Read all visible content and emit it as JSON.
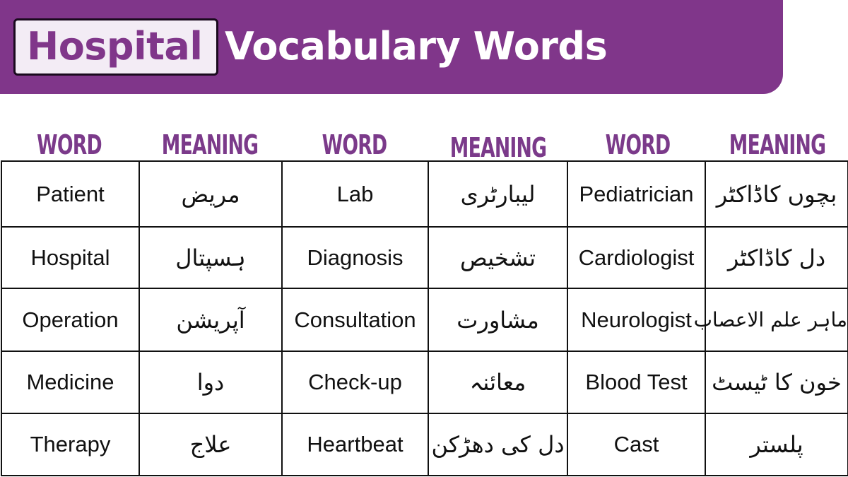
{
  "title": {
    "highlight": "Hospital",
    "rest": "Vocabulary Words"
  },
  "colors": {
    "brand_purple": "#80368a",
    "header_purple": "#7b3a8a",
    "highlight_bg": "#f3ecf5"
  },
  "headers": [
    "WORD",
    "MEANING",
    "WORD",
    "MEANING",
    "WORD",
    "MEANING"
  ],
  "rows": [
    {
      "w1": "Patient",
      "m1": "مریض",
      "w2": "Lab",
      "m2": "لیبارٹری",
      "w3": "Pediatrician",
      "m3": "بچوں کاڈاکٹر"
    },
    {
      "w1": "Hospital",
      "m1": "ہسپتال",
      "w2": "Diagnosis",
      "m2": "تشخیص",
      "w3": "Cardiologist",
      "m3": "دل کاڈاکٹر"
    },
    {
      "w1": "Operation",
      "m1": "آپریشن",
      "w2": "Consultation",
      "m2": "مشاورت",
      "w3": "Neurologist",
      "m3": "ماہر علم الاعصاب"
    },
    {
      "w1": "Medicine",
      "m1": "دوا",
      "w2": "Check-up",
      "m2": "معائنہ",
      "w3": "Blood Test",
      "m3": "خون کا ٹیسٹ"
    },
    {
      "w1": "Therapy",
      "m1": "علاج",
      "w2": "Heartbeat",
      "m2": "دل کی دھڑکن",
      "w3": "Cast",
      "m3": "پلستر"
    }
  ]
}
